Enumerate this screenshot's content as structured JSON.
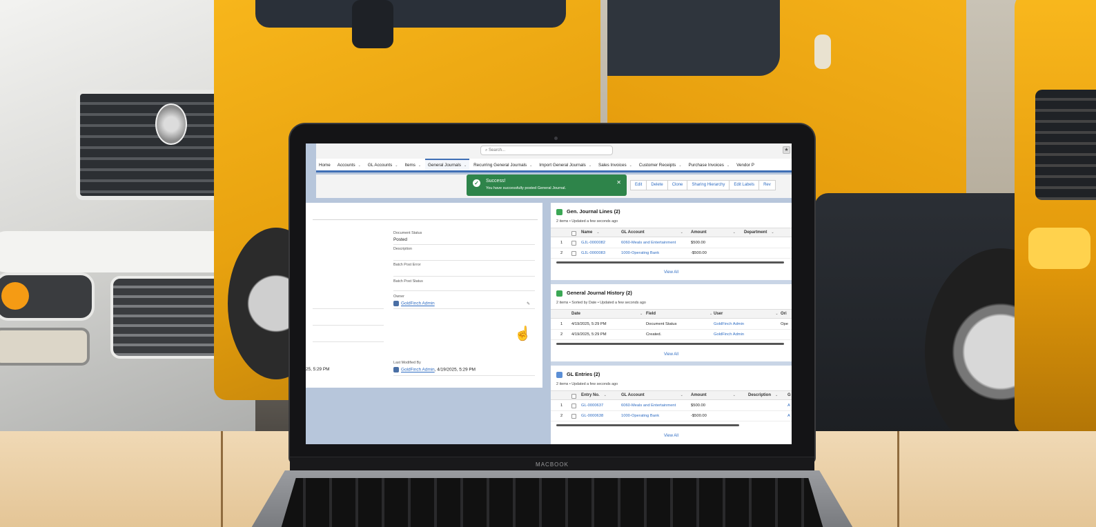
{
  "search": {
    "placeholder": "Search..."
  },
  "nav": [
    {
      "label": "Home"
    },
    {
      "label": "Accounts"
    },
    {
      "label": "GL Accounts"
    },
    {
      "label": "Items"
    },
    {
      "label": "General Journals"
    },
    {
      "label": "Recurring General Journals"
    },
    {
      "label": "Import General Journals"
    },
    {
      "label": "Sales Invoices"
    },
    {
      "label": "Customer Receipts"
    },
    {
      "label": "Purchase Invoices"
    },
    {
      "label": "Vendor P"
    }
  ],
  "actions": [
    "Edit",
    "Delete",
    "Clone",
    "Sharing Hierarchy",
    "Edit Labels",
    "Rev"
  ],
  "toast": {
    "title": "Success!",
    "message": "You have successfully posted General Journal."
  },
  "details": {
    "document_status_label": "Document Status",
    "document_status_value": "Posted",
    "description_label": "Description",
    "batch_post_error_label": "Batch Post Error",
    "batch_post_status_label": "Batch Post Status",
    "owner_label": "Owner",
    "owner_value": "GoldFinch Admin",
    "last_modified_label": "Last Modified By",
    "last_modified_user": "GoldFinch Admin",
    "last_modified_date": ", 4/19/2025, 5:29 PM",
    "created_date_partial": "25, 5:29 PM"
  },
  "journal_lines": {
    "title": "Gen. Journal Lines (2)",
    "subtitle": "2 items • Updated a few seconds ago",
    "columns": [
      "Name",
      "GL Account",
      "Amount",
      "Department"
    ],
    "rows": [
      {
        "num": "1",
        "name": "GJL-0000082",
        "gl": "6060-Meals and Entertainment",
        "amount": "$500.00"
      },
      {
        "num": "2",
        "name": "GJL-0000083",
        "gl": "1000-Operating Bank",
        "amount": "-$500.00"
      }
    ],
    "view_all": "View All"
  },
  "history": {
    "title": "General Journal History (2)",
    "subtitle": "2 items • Sorted by Date • Updated a few seconds ago",
    "columns": [
      "Date",
      "Field",
      "User",
      "Ori"
    ],
    "rows": [
      {
        "num": "1",
        "date": "4/19/2025, 5:29 PM",
        "field": "Document Status",
        "user": "GoldFinch Admin",
        "orig": "Ope"
      },
      {
        "num": "2",
        "date": "4/19/2025, 5:29 PM",
        "field": "Created.",
        "user": "GoldFinch Admin",
        "orig": ""
      }
    ],
    "view_all": "View All"
  },
  "gl_entries": {
    "title": "GL Entries (2)",
    "subtitle": "2 items • Updated a few seconds ago",
    "columns": [
      "Entry No.",
      "GL Account",
      "Amount",
      "Description",
      "G"
    ],
    "rows": [
      {
        "num": "1",
        "entry": "GL-0000637",
        "gl": "6060-Meals and Entertainment",
        "amount": "$500.00",
        "g": "A"
      },
      {
        "num": "2",
        "entry": "GL-0000638",
        "gl": "1000-Operating Bank",
        "amount": "-$500.00",
        "g": "A"
      }
    ],
    "view_all": "View All"
  },
  "laptop_brand": "MACBOOK",
  "colors": {
    "nav_accent": "#3f6fb5",
    "toast": "#2e844a",
    "link": "#2e6cc2",
    "truck_yellow": "#f5b21a"
  },
  "icons": [
    "search-icon",
    "star-icon",
    "check-icon",
    "close-icon",
    "pencil-icon",
    "hand-cursor-icon",
    "table-icon"
  ]
}
